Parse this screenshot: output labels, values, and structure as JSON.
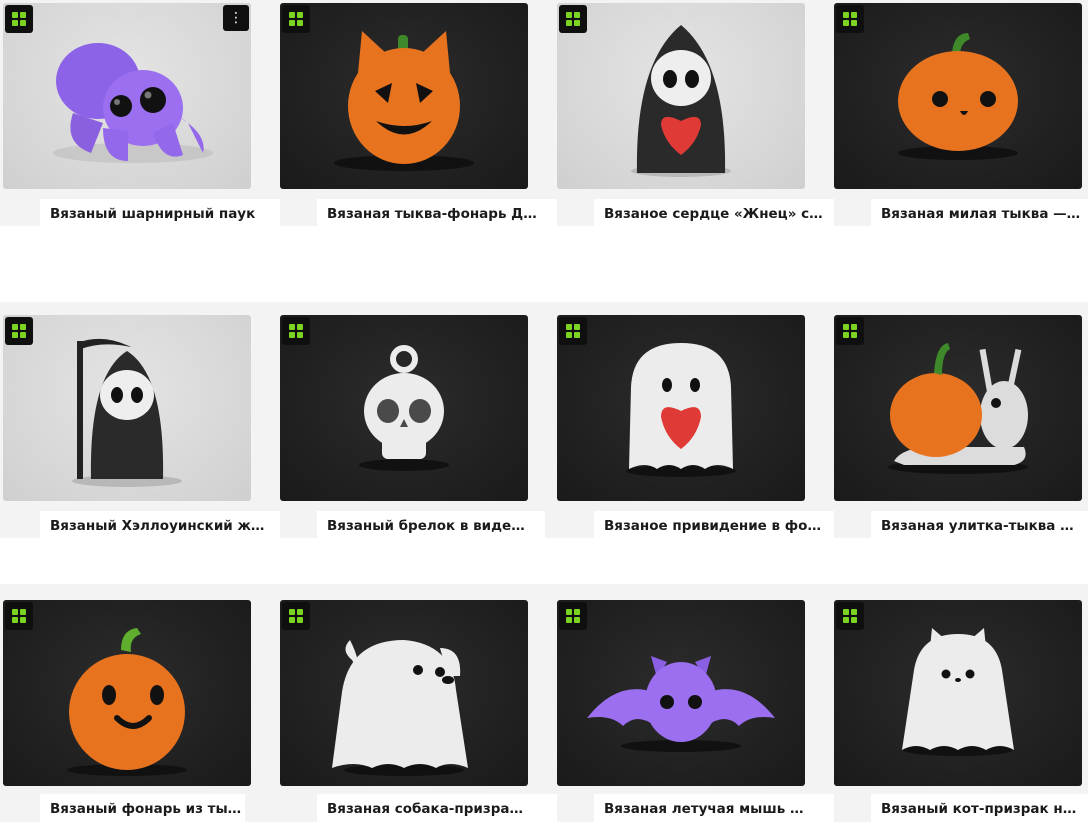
{
  "grid": {
    "cards": [
      {
        "title": "Вязаный шарнирный паук",
        "has_menu": true,
        "menu_icon": "⋮"
      },
      {
        "title": "Вязаная тыква-фонарь Джек-кот"
      },
      {
        "title": "Вязаное сердце «Жнец» с сердцем"
      },
      {
        "title": "Вязаная милая тыква — Хэллоуин"
      },
      {
        "title": "Вязаный Хэллоуинский жнец"
      },
      {
        "title": "Вязаный брелок в виде черепа"
      },
      {
        "title": "Вязаное привидение в форме сердца"
      },
      {
        "title": "Вязаная улитка-тыква на Хэллоуин"
      },
      {
        "title": "Вязаный фонарь из тыквы"
      },
      {
        "title": "Вязаная собака-призрак на Хэллоуин"
      },
      {
        "title": "Вязаная летучая мышь на Хэллоуин"
      },
      {
        "title": "Вязаный кот-призрак на Хэллоуин"
      }
    ]
  },
  "colors": {
    "badge_green": "#7dd321",
    "pumpkin": "#e8731f",
    "purple": "#9b6ff0",
    "ghost_white": "#ececec",
    "heart_red": "#e03a36",
    "reaper_black": "#2a2a2a"
  },
  "icons": {
    "badge": "knit-logo-icon",
    "menu": "more-vertical-icon"
  }
}
